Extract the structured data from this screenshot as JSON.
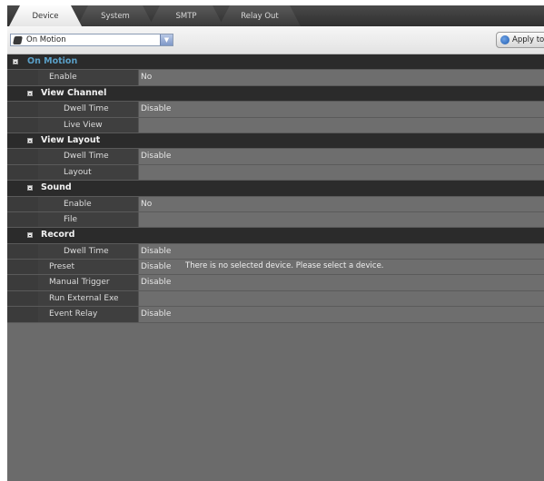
{
  "tabs": [
    {
      "label": "Device",
      "active": true
    },
    {
      "label": "System",
      "active": false
    },
    {
      "label": "SMTP",
      "active": false
    },
    {
      "label": "Relay Out",
      "active": false
    }
  ],
  "toolbar": {
    "select_value": "On Motion",
    "apply_label": "Apply to"
  },
  "grid": {
    "top_category": "On Motion",
    "enable_label": "Enable",
    "enable_value": "No",
    "view_channel": {
      "title": "View Channel",
      "dwell_label": "Dwell Time",
      "dwell_value": "Disable",
      "live_label": "Live View",
      "live_value": ""
    },
    "view_layout": {
      "title": "View Layout",
      "dwell_label": "Dwell Time",
      "dwell_value": "Disable",
      "layout_label": "Layout",
      "layout_value": ""
    },
    "sound": {
      "title": "Sound",
      "enable_label": "Enable",
      "enable_value": "No",
      "file_label": "File",
      "file_value": ""
    },
    "record": {
      "title": "Record",
      "dwell_label": "Dwell Time",
      "dwell_value": "Disable"
    },
    "preset_label": "Preset",
    "preset_value": "Disable",
    "manual_label": "Manual Trigger",
    "manual_value": "Disable",
    "runexe_label": "Run External Exe",
    "runexe_value": "",
    "relay_label": "Event Relay",
    "relay_value": "Disable"
  },
  "message": "There is no selected device. Please select a device.",
  "colors": {
    "panel_bg": "#6b6b6b",
    "category_bg": "#2b2b2b",
    "top_category_text": "#5aa0c8",
    "value_bg": "#6e6e6e"
  }
}
